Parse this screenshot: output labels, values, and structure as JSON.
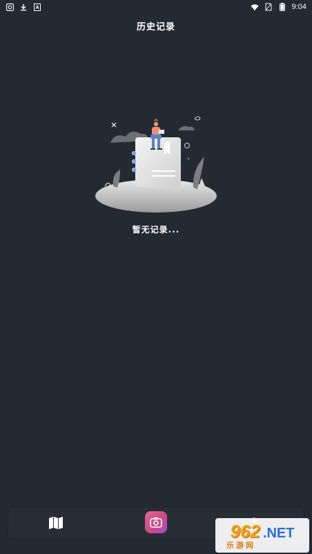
{
  "status_bar": {
    "time": "9:04",
    "left_icons": [
      "sync-icon",
      "download-icon",
      "a-box-icon"
    ],
    "right_icons": [
      "wifi-icon",
      "no-sim-icon",
      "battery-icon"
    ]
  },
  "header": {
    "title": "历史记录"
  },
  "empty_state": {
    "message": "暂无记录..."
  },
  "bottom_nav": {
    "items": [
      {
        "icon": "map-icon"
      },
      {
        "icon": "camera-icon",
        "accent": "#e6649a"
      },
      {
        "icon": "profile-icon"
      }
    ]
  },
  "watermark": {
    "number": "962",
    "domain": ".NET",
    "site": "乐游网"
  },
  "colors": {
    "background": "#232a31",
    "bar": "#262d35",
    "accent": "#e6649a"
  }
}
